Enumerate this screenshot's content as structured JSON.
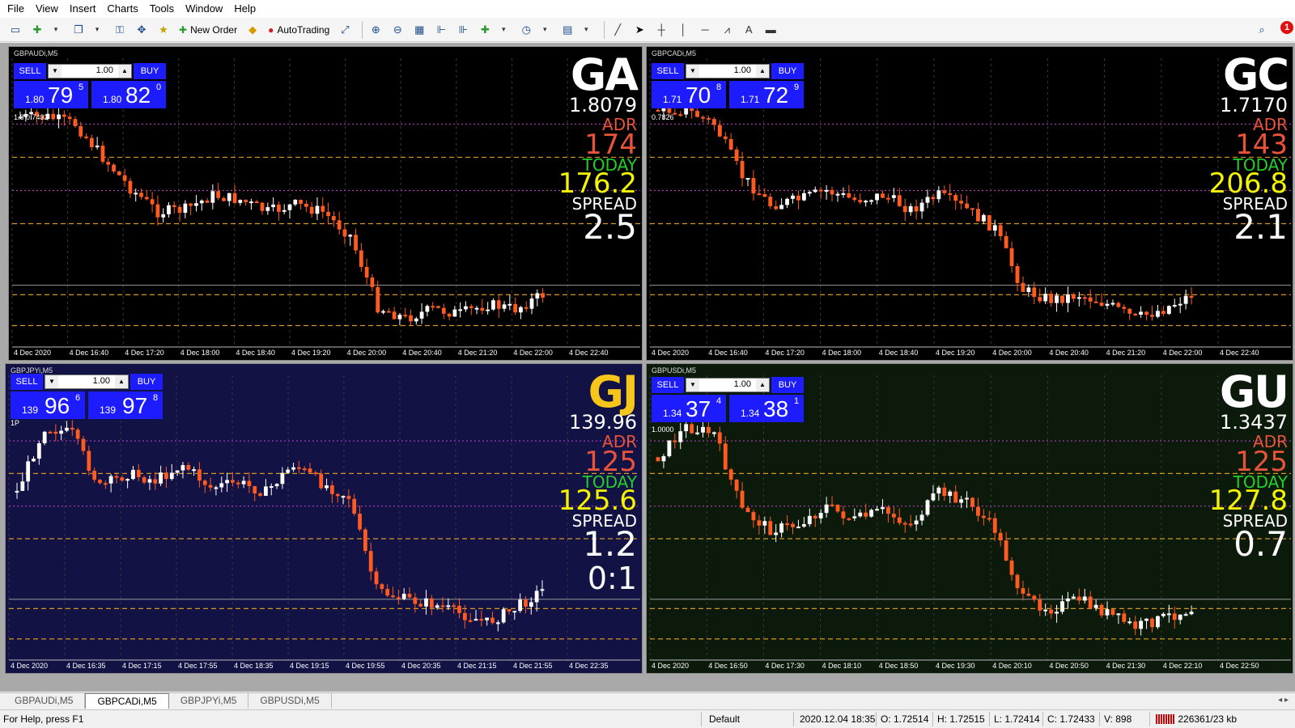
{
  "menu": [
    "File",
    "Insert",
    "Charts",
    "Tools",
    "Window",
    "Help"
  ],
  "menu_view": "View",
  "toolbar": {
    "new_order": "New Order",
    "autotrading": "AutoTrading",
    "alert_count": "1"
  },
  "colors": {
    "bull_candle": "#ffffff",
    "bear_candle": "#ff5a1f",
    "level_orange": "#d7961e",
    "level_magenta": "#b23cb8",
    "level_green": "#1fbf1f",
    "chart_bg_black": "#000000",
    "chart_bg_navy": "#121244",
    "chart_bg_green": "#0c1a0c",
    "trade_button": "#1c1cff"
  },
  "charts": [
    {
      "id": "ga",
      "title": "GBPAUDi,M5",
      "symbol": "GA",
      "price": "1.8079",
      "adr_label": "ADR",
      "adr": "174",
      "today_label": "TODAY",
      "today": "176.2",
      "spread_label": "SPREAD",
      "spread": "2.5",
      "ratio": "",
      "scale_label": "1.8 0.7432",
      "lot": "1.00",
      "sell": "SELL",
      "buy": "BUY",
      "bid": {
        "small": "1.80",
        "big": "79",
        "sup": "5"
      },
      "ask": {
        "small": "1.80",
        "big": "82",
        "sup": "0"
      },
      "x_labels": [
        "4 Dec 2020",
        "4 Dec 16:40",
        "4 Dec 17:20",
        "4 Dec 18:00",
        "4 Dec 18:40",
        "4 Dec 19:20",
        "4 Dec 20:00",
        "4 Dec 20:40",
        "4 Dec 21:20",
        "4 Dec 22:00",
        "4 Dec 22:40"
      ],
      "path": [
        0.05,
        0.05,
        0.08,
        0.22,
        0.35,
        0.45,
        0.44,
        0.38,
        0.4,
        0.45,
        0.42,
        0.45,
        0.55,
        0.85,
        0.9,
        0.86,
        0.88,
        0.84,
        0.86,
        0.8
      ]
    },
    {
      "id": "gc",
      "title": "GBPCADi,M5",
      "symbol": "GC",
      "price": "1.7170",
      "adr_label": "ADR",
      "adr": "143",
      "today_label": "TODAY",
      "today": "206.8",
      "spread_label": "SPREAD",
      "spread": "2.1",
      "ratio": "",
      "scale_label": "0.7826",
      "lot": "1.00",
      "sell": "SELL",
      "buy": "BUY",
      "bid": {
        "small": "1.71",
        "big": "70",
        "sup": "8"
      },
      "ask": {
        "small": "1.71",
        "big": "72",
        "sup": "9"
      },
      "x_labels": [
        "4 Dec 2020",
        "4 Dec 16:40",
        "4 Dec 17:20",
        "4 Dec 18:00",
        "4 Dec 18:40",
        "4 Dec 19:20",
        "4 Dec 20:00",
        "4 Dec 20:40",
        "4 Dec 21:20",
        "4 Dec 22:00",
        "4 Dec 22:40"
      ],
      "path": [
        0.02,
        0.02,
        0.08,
        0.3,
        0.42,
        0.4,
        0.36,
        0.4,
        0.38,
        0.44,
        0.38,
        0.44,
        0.52,
        0.78,
        0.82,
        0.8,
        0.84,
        0.9,
        0.86,
        0.8
      ]
    },
    {
      "id": "gj",
      "title": "GBPJPYi,M5",
      "symbol": "GJ",
      "price": "139.96",
      "adr_label": "ADR",
      "adr": "125",
      "today_label": "TODAY",
      "today": "125.6",
      "spread_label": "SPREAD",
      "spread": "1.2",
      "ratio": "0:1",
      "scale_label": "1P",
      "lot": "1.00",
      "sell": "SELL",
      "buy": "BUY",
      "bid": {
        "small": "139",
        "big": "96",
        "sup": "6"
      },
      "ask": {
        "small": "139",
        "big": "97",
        "sup": "8"
      },
      "x_labels": [
        "4 Dec 2020",
        "4 Dec 16:35",
        "4 Dec 17:15",
        "4 Dec 17:55",
        "4 Dec 18:35",
        "4 Dec 19:15",
        "4 Dec 19:55",
        "4 Dec 20:35",
        "4 Dec 21:15",
        "4 Dec 21:55",
        "4 Dec 22:35"
      ],
      "path": [
        0.3,
        0.02,
        0.05,
        0.28,
        0.22,
        0.25,
        0.18,
        0.28,
        0.26,
        0.3,
        0.18,
        0.26,
        0.32,
        0.72,
        0.76,
        0.78,
        0.82,
        0.86,
        0.8,
        0.72
      ]
    },
    {
      "id": "gu",
      "title": "GBPUSDi,M5",
      "symbol": "GU",
      "price": "1.3437",
      "adr_label": "ADR",
      "adr": "125",
      "today_label": "TODAY",
      "today": "127.8",
      "spread_label": "SPREAD",
      "spread": "0.7",
      "ratio": "",
      "scale_label": "1.0000",
      "lot": "1.00",
      "sell": "SELL",
      "buy": "BUY",
      "bid": {
        "small": "1.34",
        "big": "37",
        "sup": "4"
      },
      "ask": {
        "small": "1.34",
        "big": "38",
        "sup": "1"
      },
      "x_labels": [
        "4 Dec 2020",
        "4 Dec 16:50",
        "4 Dec 17:30",
        "4 Dec 18:10",
        "4 Dec 18:50",
        "4 Dec 19:30",
        "4 Dec 20:10",
        "4 Dec 20:50",
        "4 Dec 21:30",
        "4 Dec 22:10",
        "4 Dec 22:50"
      ],
      "path": [
        0.15,
        0.02,
        0.05,
        0.38,
        0.46,
        0.44,
        0.36,
        0.42,
        0.38,
        0.44,
        0.3,
        0.34,
        0.46,
        0.76,
        0.8,
        0.76,
        0.82,
        0.88,
        0.84,
        0.8
      ]
    }
  ],
  "tabs": [
    "GBPAUDi,M5",
    "GBPCADi,M5",
    "GBPJPYi,M5",
    "GBPUSDi,M5"
  ],
  "status": {
    "help": "For Help, press F1",
    "profile": "Default",
    "time": "2020.12.04 18:35",
    "open": "O: 1.72514",
    "high": "H: 1.72515",
    "low": "L: 1.72414",
    "close": "C: 1.72433",
    "volume": "V: 898",
    "traffic": "226361/23 kb"
  }
}
